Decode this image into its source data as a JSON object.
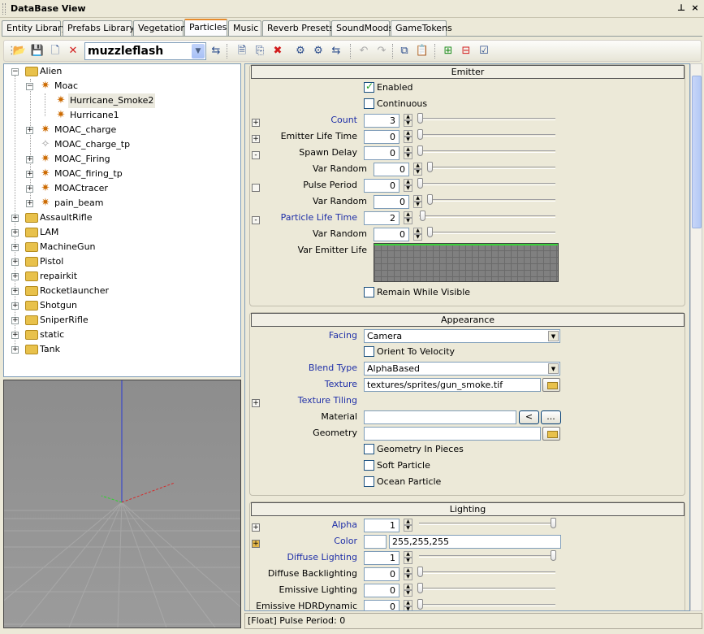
{
  "window": {
    "title": "DataBase View",
    "pin_label": "⊥",
    "close_label": "×"
  },
  "tabs": [
    {
      "label": "Entity Library"
    },
    {
      "label": "Prefabs Library"
    },
    {
      "label": "Vegetation"
    },
    {
      "label": "Particles"
    },
    {
      "label": "Music"
    },
    {
      "label": "Reverb Presets"
    },
    {
      "label": "SoundMoods"
    },
    {
      "label": "GameTokens"
    }
  ],
  "toolbar": {
    "library_value": "muzzleflash"
  },
  "tree": [
    {
      "label": "Alien",
      "type": "folder",
      "expander": "−"
    },
    {
      "label": "Moac",
      "type": "fx",
      "expander": "−"
    },
    {
      "label": "Hurricane_Smoke2",
      "type": "fx",
      "expander": ""
    },
    {
      "label": "Hurricane1",
      "type": "fx",
      "expander": ""
    },
    {
      "label": "MOAC_charge",
      "type": "fx",
      "expander": "+"
    },
    {
      "label": "MOAC_charge_tp",
      "type": "fx-empty",
      "expander": ""
    },
    {
      "label": "MOAC_Firing",
      "type": "fx",
      "expander": "+"
    },
    {
      "label": "MOAC_firing_tp",
      "type": "fx",
      "expander": "+"
    },
    {
      "label": "MOACtracer",
      "type": "fx",
      "expander": "+"
    },
    {
      "label": "pain_beam",
      "type": "fx",
      "expander": "+"
    },
    {
      "label": "AssaultRifle",
      "type": "folder",
      "expander": "+"
    },
    {
      "label": "LAM",
      "type": "folder",
      "expander": "+"
    },
    {
      "label": "MachineGun",
      "type": "folder",
      "expander": "+"
    },
    {
      "label": "Pistol",
      "type": "folder",
      "expander": "+"
    },
    {
      "label": "repairkit",
      "type": "folder",
      "expander": "+"
    },
    {
      "label": "Rocketlauncher",
      "type": "folder",
      "expander": "+"
    },
    {
      "label": "Shotgun",
      "type": "folder",
      "expander": "+"
    },
    {
      "label": "SniperRifle",
      "type": "folder",
      "expander": "+"
    },
    {
      "label": "static",
      "type": "folder",
      "expander": "+"
    },
    {
      "label": "Tank",
      "type": "folder",
      "expander": "+"
    }
  ],
  "emitter": {
    "title": "Emitter",
    "enabled_label": "Enabled",
    "enabled": true,
    "continuous_label": "Continuous",
    "continuous": false,
    "count": {
      "label": "Count",
      "value": "3",
      "pm": "+"
    },
    "emitter_life_time": {
      "label": "Emitter Life Time",
      "value": "0",
      "pm": "+"
    },
    "spawn_delay": {
      "label": "Spawn Delay",
      "value": "0",
      "pm": "-"
    },
    "spawn_var_random": {
      "label": "Var Random",
      "value": "0"
    },
    "pulse_period": {
      "label": "Pulse Period",
      "value": "0"
    },
    "pulse_var_random": {
      "label": "Var Random",
      "value": "0"
    },
    "particle_life_time": {
      "label": "Particle Life Time",
      "value": "2",
      "pm": "-"
    },
    "life_var_random": {
      "label": "Var Random",
      "value": "0"
    },
    "var_emitter_life_label": "Var Emitter Life",
    "remain_while_visible_label": "Remain While Visible"
  },
  "appearance": {
    "title": "Appearance",
    "facing": {
      "label": "Facing",
      "value": "Camera"
    },
    "orient_to_velocity_label": "Orient To Velocity",
    "blend_type": {
      "label": "Blend Type",
      "value": "AlphaBased"
    },
    "texture": {
      "label": "Texture",
      "value": "textures/sprites/gun_smoke.tif"
    },
    "texture_tiling_label": "Texture Tiling",
    "texture_tiling_pm": "+",
    "material": {
      "label": "Material",
      "value": "",
      "btn_back": "<",
      "btn_more": "..."
    },
    "geometry": {
      "label": "Geometry",
      "value": ""
    },
    "geometry_in_pieces_label": "Geometry In Pieces",
    "soft_particle_label": "Soft Particle",
    "ocean_particle_label": "Ocean Particle"
  },
  "lighting": {
    "title": "Lighting",
    "alpha": {
      "label": "Alpha",
      "value": "1",
      "pm": "+"
    },
    "color": {
      "label": "Color",
      "value": "255,255,255",
      "pm": "+"
    },
    "diffuse_lighting": {
      "label": "Diffuse Lighting",
      "value": "1"
    },
    "diffuse_backlighting": {
      "label": "Diffuse Backlighting",
      "value": "0"
    },
    "emissive_lighting": {
      "label": "Emissive Lighting",
      "value": "0"
    },
    "emissive_hdr": {
      "label": "Emissive HDRDynamic",
      "value": "0"
    }
  },
  "status": {
    "text": "[Float] Pulse Period: 0"
  },
  "colors": {
    "accent_tab": "#e68b2c",
    "label_blue": "#1f2fa8",
    "curve_green": "#3cd13c"
  }
}
